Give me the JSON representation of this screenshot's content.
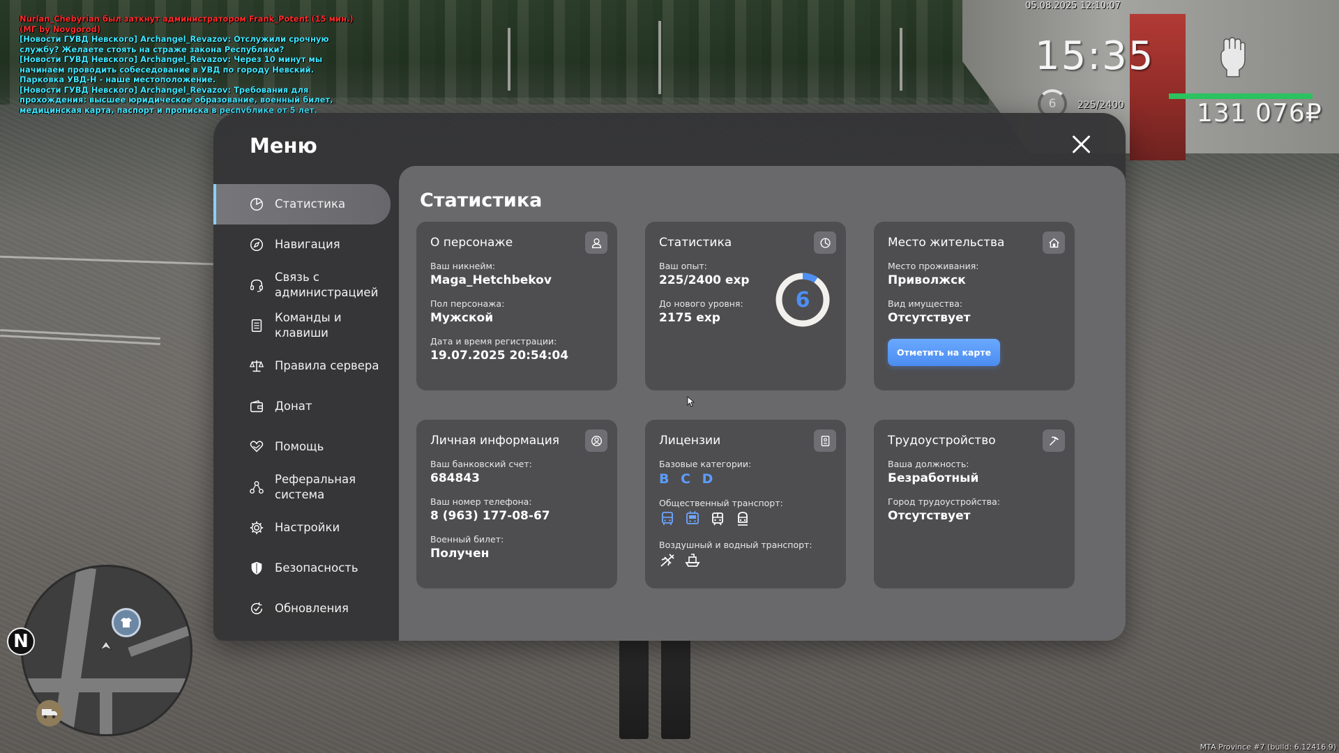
{
  "chat": [
    {
      "color": "#ff2b2b",
      "text": "Nurlan_Chebyrian был заткнут администратором Frank_Potent (15 мин.) (МГ by Novgorod)"
    },
    {
      "color": "#3fe7ff",
      "text": "[Новости ГУВД Невского] Archangel_Revazov: Отслужили срочную службу? Желаете стоять на страже закона Республики?"
    },
    {
      "color": "#3fe7ff",
      "text": "[Новости ГУВД Невского] Archangel_Revazov: Через 10 минут мы начинаем проводить собеседование в УВД по городу Невский. Парковка УВД-Н - наше местоположение."
    },
    {
      "color": "#3fe7ff",
      "text": "[Новости ГУВД Невского] Archangel_Revazov: Требования для прохождения: высшее юридическое образование, военный билет, медицинская карта, паспорт и прописка в республике от 5 лет."
    }
  ],
  "hud": {
    "datetime": "05.08.2025 12:10:07",
    "time": "15:35",
    "level": "6",
    "exp": "225/2400",
    "money": "131 076₽",
    "health_fraction": 1.0
  },
  "build_info": "MTA Province #7 (build: 6.12416.9)",
  "minimap": {
    "north": "N"
  },
  "menu": {
    "title": "Меню",
    "sidebar": [
      {
        "label": "Статистика",
        "icon": "pie-chart-icon",
        "active": true
      },
      {
        "label": "Навигация",
        "icon": "compass-icon"
      },
      {
        "label": "Связь с администрацией",
        "icon": "headset-icon"
      },
      {
        "label": "Команды и клавиши",
        "icon": "document-list-icon"
      },
      {
        "label": "Правила сервера",
        "icon": "scales-icon"
      },
      {
        "label": "Донат",
        "icon": "wallet-icon"
      },
      {
        "label": "Помощь",
        "icon": "heart-hands-icon"
      },
      {
        "label": "Реферальная система",
        "icon": "referral-network-icon"
      },
      {
        "label": "Настройки",
        "icon": "gear-icon"
      },
      {
        "label": "Безопасность",
        "icon": "shield-icon"
      },
      {
        "label": "Обновления",
        "icon": "refresh-check-icon"
      }
    ],
    "content": {
      "title": "Статистика",
      "character": {
        "title": "О персонаже",
        "nick_label": "Ваш никнейм:",
        "nick": "Maga_Hetchbekov",
        "gender_label": "Пол персонажа:",
        "gender": "Мужской",
        "reg_label": "Дата и время регистрации:",
        "reg": "19.07.2025 20:54:04"
      },
      "stats": {
        "title": "Статистика",
        "exp_label": "Ваш опыт:",
        "exp": "225/2400 exp",
        "next_label": "До нового уровня:",
        "next": "2175 exp",
        "level": "6",
        "progress": 0.094
      },
      "residence": {
        "title": "Место жительства",
        "place_label": "Место проживания:",
        "place": "Приволжск",
        "property_label": "Вид имущества:",
        "property": "Отсутствует",
        "button": "Отметить на карте"
      },
      "personal": {
        "title": "Личная информация",
        "bank_label": "Ваш банковский счет:",
        "bank": "684843",
        "phone_label": "Ваш номер телефона:",
        "phone": "8 (963) 177-08-67",
        "military_label": "Военный билет:",
        "military": "Получен"
      },
      "licenses": {
        "title": "Лицензии",
        "base_label": "Базовые категории:",
        "base": "B C D",
        "public_label": "Общественный транспорт:",
        "public_icons": [
          "bus-icon",
          "trolleybus-icon",
          "tram-icon",
          "metro-icon"
        ],
        "air_label": "Воздушный и водный транспорт:",
        "air_icons": [
          "plane-icon",
          "boat-icon"
        ]
      },
      "job": {
        "title": "Трудоустройство",
        "position_label": "Ваша должность:",
        "position": "Безработный",
        "city_label": "Город трудоустройства:",
        "city": "Отсутствует"
      }
    }
  },
  "colors": {
    "accent": "#4d8ff5",
    "active_bar": "#8ad0ff",
    "button": "#5b9cff"
  }
}
